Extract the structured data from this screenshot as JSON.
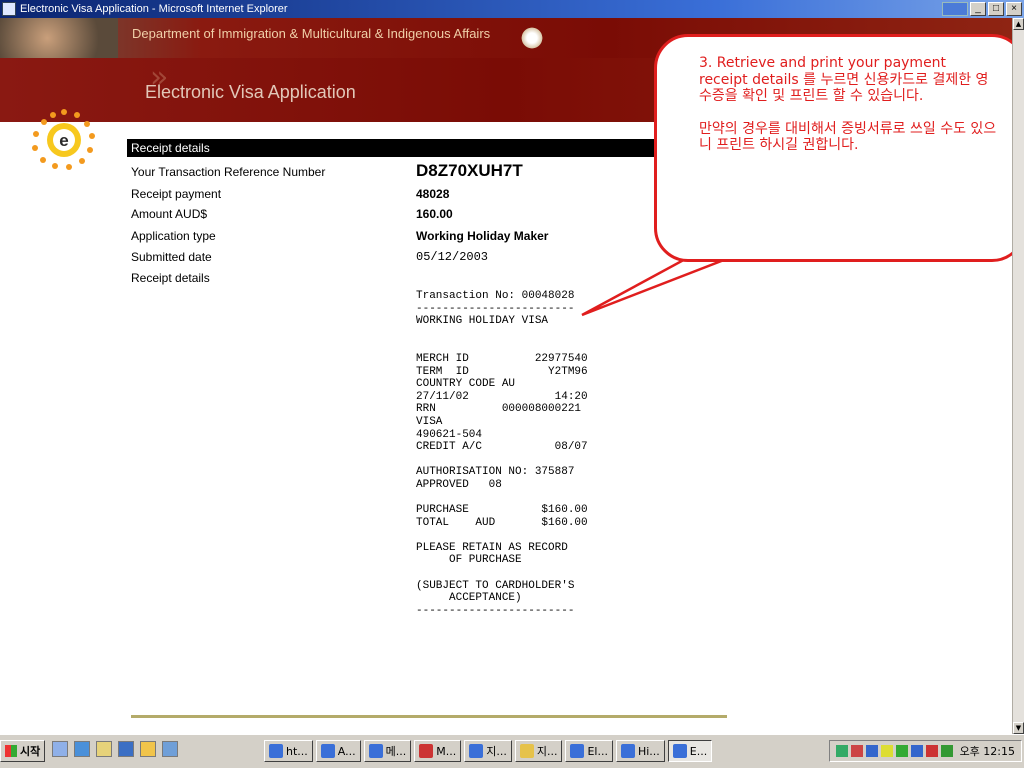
{
  "window": {
    "title": "Electronic Visa Application - Microsoft Internet Explorer"
  },
  "banner": {
    "department": "Department of Immigration & Multicultural & Indigenous Affairs",
    "app_title": "Electronic Visa Application"
  },
  "receipt_section": {
    "header": "Receipt details",
    "rows": [
      {
        "label": "Your Transaction Reference Number",
        "value": "D8Z70XUH7T"
      },
      {
        "label": "Receipt payment",
        "value": "48028"
      },
      {
        "label": "Amount AUD$",
        "value": "160.00"
      },
      {
        "label": "Application type",
        "value": "Working Holiday Maker"
      },
      {
        "label": "Submitted date",
        "value": "05/12/2003"
      },
      {
        "label": "Receipt details",
        "value": ""
      }
    ],
    "receipt_lines": [
      "Transaction No: 00048028",
      "------------------------",
      "WORKING HOLIDAY VISA",
      "",
      "",
      "MERCH ID          22977540",
      "TERM  ID            Y2TM96",
      "COUNTRY CODE AU",
      "27/11/02             14:20",
      "RRN          000008000221",
      "VISA",
      "490621-504",
      "CREDIT A/C           08/07",
      "",
      "AUTHORISATION NO: 375887",
      "APPROVED   08",
      "",
      "PURCHASE           $160.00",
      "TOTAL    AUD       $160.00",
      "",
      "PLEASE RETAIN AS RECORD",
      "     OF PURCHASE",
      "",
      "(SUBJECT TO CARDHOLDER'S",
      "     ACCEPTANCE)",
      "------------------------"
    ]
  },
  "callout": {
    "line1": "3. Retrieve and print your payment receipt details 를 누르면 신용카드로 결제한 영수증을 확인 및 프린트 할 수 있습니다.",
    "line2": "만약의 경우를 대비해서 증빙서류로 쓰일 수도 있으니 프린트 하시길 권합니다.",
    "color": "#e01e1e"
  },
  "taskbar": {
    "start_label": "시작",
    "tasks": [
      "ht...",
      "A...",
      "메...",
      "M...",
      "지...",
      "지...",
      "El...",
      "Hi...",
      "E..."
    ],
    "clock": "오후 12:15"
  },
  "colors": {
    "banner": "#7a0c05",
    "callout": "#e01e1e"
  }
}
